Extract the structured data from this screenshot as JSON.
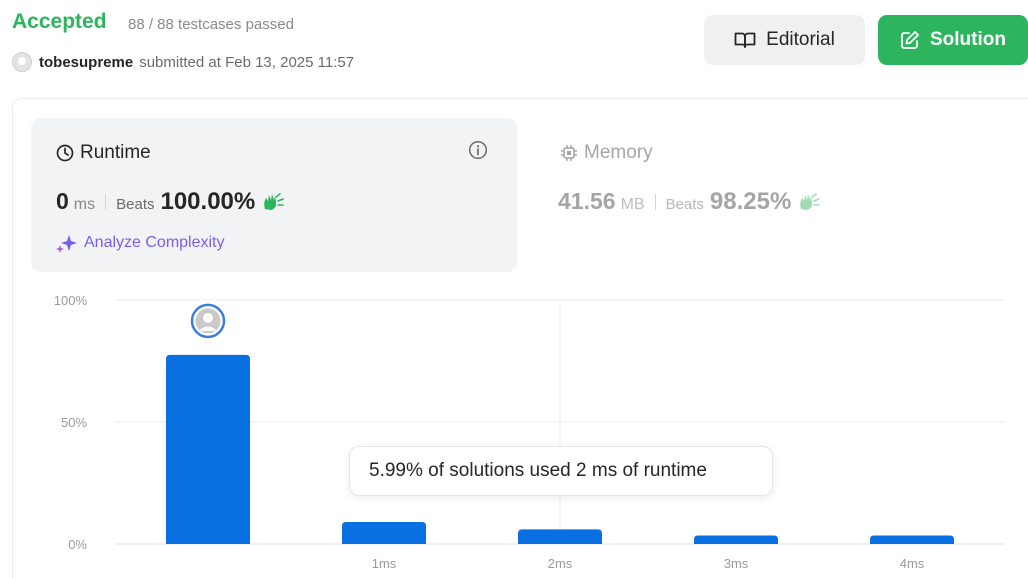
{
  "header": {
    "status": "Accepted",
    "testcases": "88 / 88 testcases passed",
    "username": "tobesupreme",
    "submitted": "submitted at Feb 13, 2025 11:57",
    "editorial_label": "Editorial",
    "solution_label": "Solution"
  },
  "runtime": {
    "title": "Runtime",
    "value": "0",
    "unit": "ms",
    "beats_label": "Beats",
    "beats_value": "100.00%",
    "analyze_label": "Analyze Complexity"
  },
  "memory": {
    "title": "Memory",
    "value": "41.56",
    "unit": "MB",
    "beats_label": "Beats",
    "beats_value": "98.25%"
  },
  "tooltip": "5.99% of solutions used 2 ms of runtime",
  "colors": {
    "accepted": "#2db55d",
    "bar": "#0a6fe0",
    "analyze": "#7b5cf0"
  },
  "chart_data": {
    "type": "bar",
    "categories": [
      "0ms",
      "1ms",
      "2ms",
      "3ms",
      "4ms"
    ],
    "x_tick_labels": [
      "",
      "1ms",
      "2ms",
      "3ms",
      "4ms"
    ],
    "values": [
      77.5,
      9,
      5.99,
      3.5,
      3.5
    ],
    "y_tick_labels": [
      "100%",
      "50%",
      "0%"
    ],
    "ylim": [
      0,
      100
    ],
    "grid": true,
    "highlight_index": 0
  }
}
